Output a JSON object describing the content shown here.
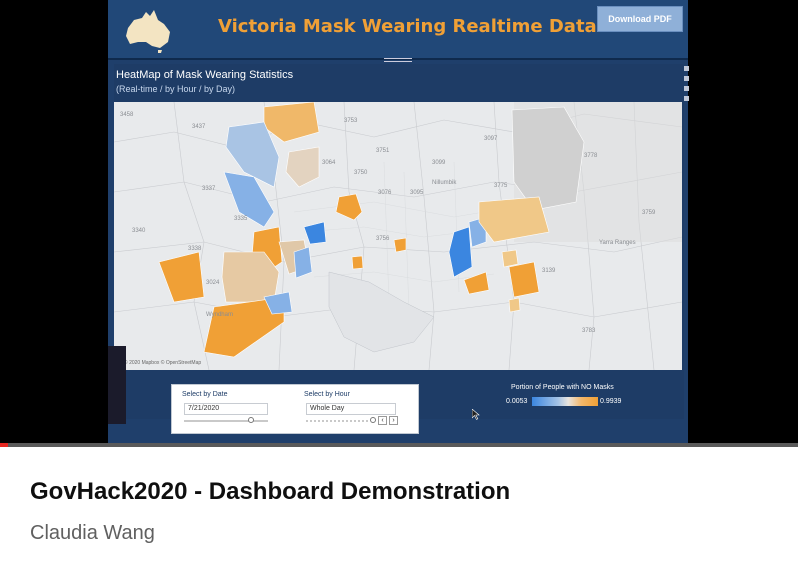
{
  "dashboard": {
    "title": "Victoria Mask Wearing Realtime Data",
    "download_label": "Download PDF",
    "accent_color": "#f0a036",
    "header_color": "#214878"
  },
  "panel": {
    "title": "HeatMap of Mask Wearing Statistics",
    "subtitle": "(Real-time / by Hour / by Day)",
    "map_attribution": "© 2020 Mapbox © OpenStreetMap",
    "map_labels": [
      "3458",
      "3437",
      "3753",
      "3751",
      "3064",
      "3750",
      "3099",
      "3097",
      "3778",
      "Nillumbik",
      "3337",
      "3775",
      "3335",
      "3340",
      "3759",
      "3338",
      "Yarra Ranges",
      "3024",
      "3139",
      "3783",
      "Wyndham",
      "3756",
      "3076",
      "3095"
    ]
  },
  "controls": {
    "date_label": "Select by Date",
    "date_value": "7/21/2020",
    "hour_label": "Select by Hour",
    "hour_value": "Whole Day",
    "date_slider_position": 0.8
  },
  "legend": {
    "title": "Portion of People with NO Masks",
    "min": "0.0053",
    "max": "0.9939",
    "low_color": "#3b86e0",
    "high_color": "#f0a036"
  },
  "video": {
    "title": "GovHack2020 - Dashboard Demonstration",
    "channel": "Claudia Wang",
    "progress": 0.01
  }
}
